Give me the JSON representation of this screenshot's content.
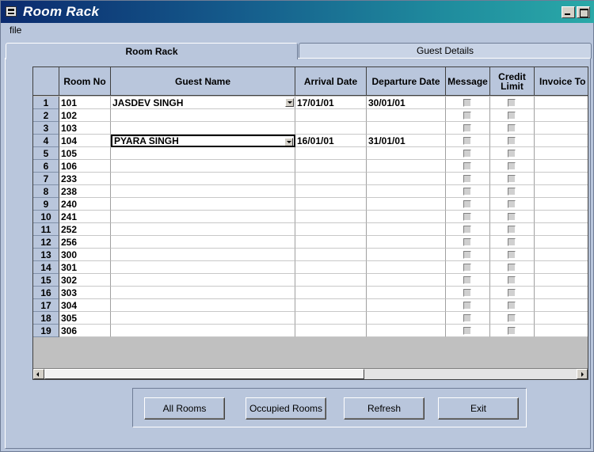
{
  "window": {
    "title": "Room Rack"
  },
  "menu": {
    "file_label": "file"
  },
  "tabs": [
    {
      "label": "Room Rack",
      "active": true
    },
    {
      "label": "Guest Details",
      "active": false
    }
  ],
  "grid": {
    "columns": [
      "Room No",
      "Guest Name",
      "Arrival Date",
      "Departure Date",
      "Message",
      "Credit Limit",
      "Invoice To"
    ],
    "rows": [
      {
        "n": "1",
        "room": "101",
        "guest": "JASDEV SINGH",
        "arrival": "17/01/01",
        "departure": "30/01/01",
        "dropdown": true,
        "focus": false
      },
      {
        "n": "2",
        "room": "102",
        "guest": "",
        "arrival": "",
        "departure": ""
      },
      {
        "n": "3",
        "room": "103",
        "guest": "",
        "arrival": "",
        "departure": ""
      },
      {
        "n": "4",
        "room": "104",
        "guest": "PYARA SINGH",
        "arrival": "16/01/01",
        "departure": "31/01/01",
        "dropdown": true,
        "focus": true
      },
      {
        "n": "5",
        "room": "105",
        "guest": "",
        "arrival": "",
        "departure": ""
      },
      {
        "n": "6",
        "room": "106",
        "guest": "",
        "arrival": "",
        "departure": ""
      },
      {
        "n": "7",
        "room": "233",
        "guest": "",
        "arrival": "",
        "departure": ""
      },
      {
        "n": "8",
        "room": "238",
        "guest": "",
        "arrival": "",
        "departure": ""
      },
      {
        "n": "9",
        "room": "240",
        "guest": "",
        "arrival": "",
        "departure": ""
      },
      {
        "n": "10",
        "room": "241",
        "guest": "",
        "arrival": "",
        "departure": ""
      },
      {
        "n": "11",
        "room": "252",
        "guest": "",
        "arrival": "",
        "departure": ""
      },
      {
        "n": "12",
        "room": "256",
        "guest": "",
        "arrival": "",
        "departure": ""
      },
      {
        "n": "13",
        "room": "300",
        "guest": "",
        "arrival": "",
        "departure": ""
      },
      {
        "n": "14",
        "room": "301",
        "guest": "",
        "arrival": "",
        "departure": ""
      },
      {
        "n": "15",
        "room": "302",
        "guest": "",
        "arrival": "",
        "departure": ""
      },
      {
        "n": "16",
        "room": "303",
        "guest": "",
        "arrival": "",
        "departure": ""
      },
      {
        "n": "17",
        "room": "304",
        "guest": "",
        "arrival": "",
        "departure": ""
      },
      {
        "n": "18",
        "room": "305",
        "guest": "",
        "arrival": "",
        "departure": ""
      },
      {
        "n": "19",
        "room": "306",
        "guest": "",
        "arrival": "",
        "departure": ""
      }
    ]
  },
  "buttons": {
    "all_rooms": "All Rooms",
    "occupied_rooms": "Occupied Rooms",
    "refresh": "Refresh",
    "exit": "Exit"
  },
  "colors": {
    "window_bg": "#b9c6dc",
    "titlebar_start": "#0b2a6e",
    "titlebar_end": "#2aa9a8"
  }
}
